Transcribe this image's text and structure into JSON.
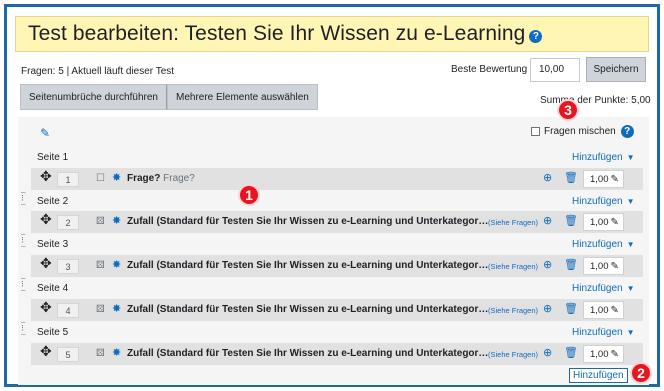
{
  "title": "Test bearbeiten: Testen Sie Ihr Wissen zu e-Learning",
  "summary": "Fragen: 5 | Aktuell läuft dieser Test",
  "best_grade_label": "Beste Bewertung",
  "best_grade_value": "10,00",
  "save_label": "Speichern",
  "btn_repaginate": "Seitenumbrüche durchführen",
  "btn_select_multiple": "Mehrere Elemente auswählen",
  "total_marks": "Summe der Punkte: 5,00",
  "shuffle_label": "Fragen mischen",
  "add_label": "Hinzufügen",
  "see_questions": "(Siehe Fragen)",
  "sections": [
    {
      "label": "Seite 1"
    },
    {
      "label": "Seite 2"
    },
    {
      "label": "Seite 3"
    },
    {
      "label": "Seite 4"
    },
    {
      "label": "Seite 5"
    }
  ],
  "slots": [
    {
      "num": "1",
      "name": "Frage?",
      "text": "Frage?",
      "mark": "1,00",
      "type_icon": "question-square-icon"
    },
    {
      "num": "2",
      "name": "Zufall (Standard für Testen Sie Ihr Wissen zu e-Learning und Unterkategor…",
      "mark": "1,00",
      "type_icon": "random-icon"
    },
    {
      "num": "3",
      "name": "Zufall (Standard für Testen Sie Ihr Wissen zu e-Learning und Unterkategor…",
      "mark": "1,00",
      "type_icon": "random-icon"
    },
    {
      "num": "4",
      "name": "Zufall (Standard für Testen Sie Ihr Wissen zu e-Learning und Unterkategor…",
      "mark": "1,00",
      "type_icon": "random-icon"
    },
    {
      "num": "5",
      "name": "Zufall (Standard für Testen Sie Ihr Wissen zu e-Learning und Unterkategor…",
      "mark": "1,00",
      "type_icon": "random-icon"
    }
  ],
  "annotations": [
    "1",
    "2",
    "3"
  ],
  "colors": {
    "accent": "#0f6cbf",
    "title_bg": "#fff5b4",
    "badge": "#e8141f",
    "frame": "#1f6aa5"
  }
}
